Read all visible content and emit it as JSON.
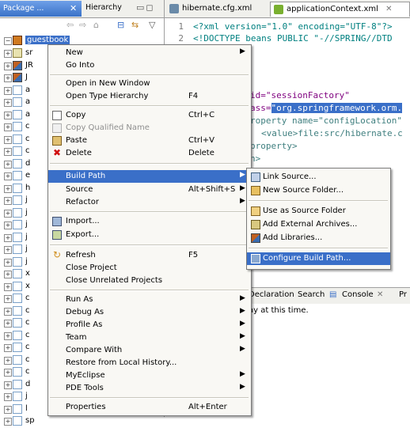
{
  "left_panel": {
    "active_tab": "Package ...",
    "inactive_tab": "Hierarchy",
    "project": "guestbook",
    "rows": [
      {
        "label": "sr",
        "icon": "source-folder-icon"
      },
      {
        "label": "JR",
        "icon": "library-icon"
      },
      {
        "label": "J",
        "icon": "library-icon"
      },
      {
        "label": "a",
        "icon": "jar-icon"
      },
      {
        "label": "a",
        "icon": "jar-icon"
      },
      {
        "label": "a",
        "icon": "jar-icon"
      },
      {
        "label": "c",
        "icon": "jar-icon"
      },
      {
        "label": "c",
        "icon": "jar-icon"
      },
      {
        "label": "c",
        "icon": "jar-icon"
      },
      {
        "label": "d",
        "icon": "jar-icon"
      },
      {
        "label": "e",
        "icon": "jar-icon"
      },
      {
        "label": "h",
        "icon": "jar-icon"
      },
      {
        "label": "j",
        "icon": "jar-icon"
      },
      {
        "label": "j",
        "icon": "jar-icon"
      },
      {
        "label": "j",
        "icon": "jar-icon"
      },
      {
        "label": "j",
        "icon": "jar-icon"
      },
      {
        "label": "j",
        "icon": "jar-icon"
      },
      {
        "label": "j",
        "icon": "jar-icon"
      },
      {
        "label": "x",
        "icon": "jar-icon"
      },
      {
        "label": "x",
        "icon": "jar-icon"
      },
      {
        "label": "c",
        "icon": "jar-icon"
      },
      {
        "label": "c",
        "icon": "jar-icon"
      },
      {
        "label": "c",
        "icon": "jar-icon"
      },
      {
        "label": "c",
        "icon": "jar-icon"
      },
      {
        "label": "c",
        "icon": "jar-icon"
      },
      {
        "label": "c",
        "icon": "jar-icon"
      },
      {
        "label": "c",
        "icon": "jar-icon"
      },
      {
        "label": "d",
        "icon": "jar-icon"
      },
      {
        "label": "j",
        "icon": "jar-icon"
      },
      {
        "label": "l",
        "icon": "jar-icon"
      },
      {
        "label": "sp",
        "icon": "jar-icon"
      }
    ]
  },
  "editor": {
    "tabs": [
      {
        "label": "hibernate.cfg.xml",
        "icon": "xml-file-icon"
      },
      {
        "label": "applicationContext.xml",
        "icon": "spring-leaf-icon",
        "close": "✕"
      }
    ],
    "lines": [
      {
        "num": "1",
        "text": "<?xml version=\"1.0\" encoding=\"UTF-8\"?>"
      },
      {
        "num": "2",
        "text": "<!DOCTYPE beans PUBLIC \"-//SPRING//DTD"
      }
    ],
    "snippets": {
      "s1": "id=\"sessionFactory\"",
      "s2_pre": "ass=",
      "s2_hl": "\"org.springframework.orm.",
      "s3": "roperty name=\"configLocation\"",
      "s4": "<value>file:src/hibernate.c",
      "s5": "property>",
      "s6": "n>"
    }
  },
  "console": {
    "tabs": {
      "declaration": "Declaration",
      "search": "Search",
      "console": "Console",
      "console_close": "✕",
      "problems": "Pr"
    },
    "text": "ay at this time."
  },
  "context_menu": {
    "items": [
      {
        "label": "New",
        "accel": "",
        "submenu": true
      },
      {
        "label": "Go Into",
        "accel": ""
      },
      {
        "label": "Open in New Window",
        "accel": ""
      },
      {
        "label": "Open Type Hierarchy",
        "accel": "F4"
      },
      {
        "label": "Copy",
        "accel": "Ctrl+C",
        "icon": "copy-icon"
      },
      {
        "label": "Copy Qualified Name",
        "accel": "",
        "disabled": true,
        "icon": "copy-qualified-icon"
      },
      {
        "label": "Paste",
        "accel": "Ctrl+V",
        "icon": "paste-icon"
      },
      {
        "label": "Delete",
        "accel": "Delete",
        "icon": "delete-icon"
      },
      {
        "label": "Build Path",
        "accel": "",
        "submenu": true
      },
      {
        "label": "Source",
        "accel": "Alt+Shift+S",
        "submenu": true
      },
      {
        "label": "Refactor",
        "accel": "",
        "submenu": true
      },
      {
        "label": "Import...",
        "accel": "",
        "icon": "import-icon"
      },
      {
        "label": "Export...",
        "accel": "",
        "icon": "export-icon"
      },
      {
        "label": "Refresh",
        "accel": "F5",
        "icon": "refresh-icon"
      },
      {
        "label": "Close Project",
        "accel": ""
      },
      {
        "label": "Close Unrelated Projects",
        "accel": ""
      },
      {
        "label": "Run As",
        "accel": "",
        "submenu": true
      },
      {
        "label": "Debug As",
        "accel": "",
        "submenu": true
      },
      {
        "label": "Profile As",
        "accel": "",
        "submenu": true
      },
      {
        "label": "Team",
        "accel": "",
        "submenu": true
      },
      {
        "label": "Compare With",
        "accel": "",
        "submenu": true
      },
      {
        "label": "Restore from Local History...",
        "accel": ""
      },
      {
        "label": "MyEclipse",
        "accel": "",
        "submenu": true
      },
      {
        "label": "PDE Tools",
        "accel": "",
        "submenu": true
      },
      {
        "label": "Properties",
        "accel": "Alt+Enter"
      }
    ],
    "submenu_arrow": "▶"
  },
  "build_path_submenu": {
    "items": [
      {
        "label": "Link Source...",
        "icon": "link-source-icon"
      },
      {
        "label": "New Source Folder...",
        "icon": "new-source-folder-icon"
      },
      {
        "label": "Use as Source Folder",
        "icon": "use-as-source-icon"
      },
      {
        "label": "Add External Archives...",
        "icon": "add-external-archives-icon"
      },
      {
        "label": "Add Libraries...",
        "icon": "add-libraries-icon"
      },
      {
        "label": "Configure Build Path...",
        "icon": "configure-build-path-icon"
      }
    ]
  },
  "colors": {
    "selection": "#3a6fc8",
    "menu_bg": "#f9f8f4",
    "xml_tag": "#3f7f7f",
    "xml_attr": "#7f007f",
    "xml_string": "#2a00ff"
  }
}
